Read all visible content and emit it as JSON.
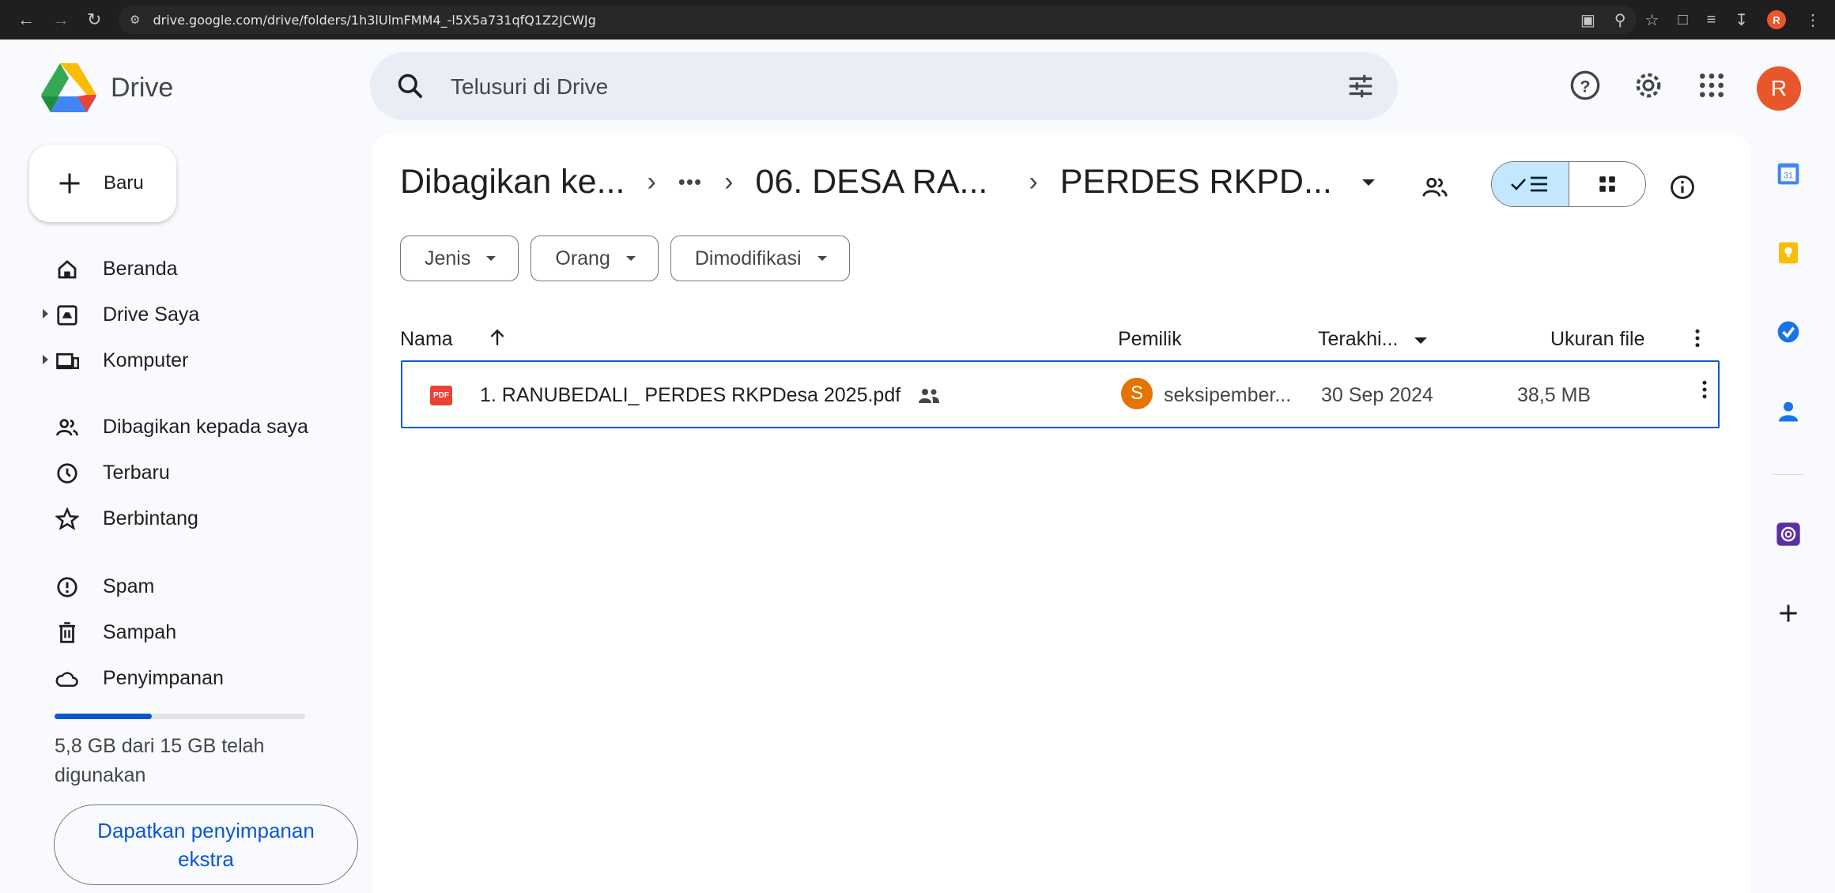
{
  "browser": {
    "url": "drive.google.com/drive/folders/1h3lUlmFMM4_-l5X5a731qfQ1Z2JCWJg",
    "profile_initial": "R"
  },
  "app": {
    "name": "Drive",
    "search_placeholder": "Telusuri di Drive",
    "avatar_initial": "R"
  },
  "sidebar": {
    "new_label": "Baru",
    "items": [
      {
        "label": "Beranda",
        "icon": "home-icon"
      },
      {
        "label": "Drive Saya",
        "icon": "my-drive-icon"
      },
      {
        "label": "Komputer",
        "icon": "computer-icon"
      },
      {
        "label": "Dibagikan kepada saya",
        "icon": "shared-icon"
      },
      {
        "label": "Terbaru",
        "icon": "clock-icon"
      },
      {
        "label": "Berbintang",
        "icon": "star-icon"
      },
      {
        "label": "Spam",
        "icon": "spam-icon"
      },
      {
        "label": "Sampah",
        "icon": "trash-icon"
      },
      {
        "label": "Penyimpanan",
        "icon": "cloud-icon"
      }
    ],
    "storage": {
      "used_fraction": 0.387,
      "text": "5,8 GB dari 15 GB telah digunakan"
    },
    "get_storage_label": "Dapatkan penyimpanan ekstra"
  },
  "breadcrumb": {
    "items": [
      "Dibagikan ke...",
      "06. DESA RA...",
      "PERDES RKPD..."
    ],
    "more": "•••"
  },
  "filters": [
    "Jenis",
    "Orang",
    "Dimodifikasi"
  ],
  "table": {
    "columns": {
      "name": "Nama",
      "owner": "Pemilik",
      "modified": "Terakhi...",
      "size": "Ukuran file"
    },
    "rows": [
      {
        "name": "1. RANUBEDALI_ PERDES RKPDesa 2025.pdf",
        "file_type": "PDF",
        "owner_initial": "S",
        "owner": "seksipember...",
        "modified": "30 Sep 2024",
        "size": "38,5 MB"
      }
    ]
  },
  "colors": {
    "accent": "#0b57d0",
    "selected_toggle": "#c2e7ff",
    "pdf_red": "#ea4335",
    "avatar_orange": "#e8572c",
    "owner_avatar": "#e37400"
  }
}
